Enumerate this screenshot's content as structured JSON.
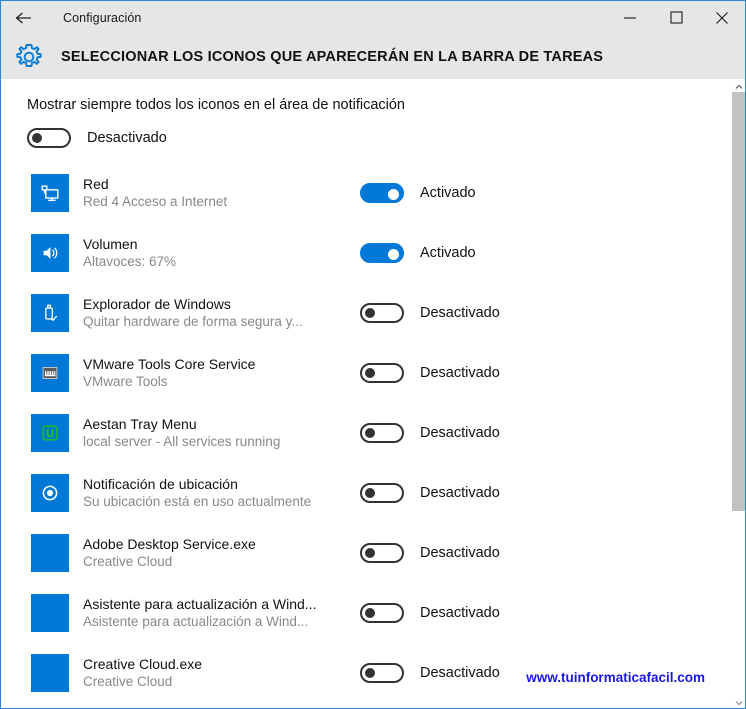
{
  "window": {
    "title": "Configuración",
    "back_icon": "back-arrow-icon",
    "minimize_label": "–",
    "maximize_label": "□",
    "close_label": "✕"
  },
  "header": {
    "icon": "gear-icon",
    "heading": "SELECCIONAR LOS ICONOS QUE APARECERÁN EN LA BARRA DE TAREAS"
  },
  "colors": {
    "accent": "#0078d7",
    "titlebar_bg": "#e6e6e6",
    "border": "#2b88d8",
    "watermark": "#1a18e8",
    "subtitle": "#888888"
  },
  "main": {
    "show_all_label": "Mostrar siempre todos los iconos en el área de notificación",
    "show_all_toggle": {
      "state": "off",
      "label": "Desactivado"
    },
    "items": [
      {
        "icon": "network-monitor-icon",
        "name": "Red",
        "subtitle": "Red  4 Acceso a Internet",
        "toggle": {
          "state": "on",
          "label": "Activado"
        }
      },
      {
        "icon": "volume-speaker-icon",
        "name": "Volumen",
        "subtitle": "Altavoces: 67%",
        "toggle": {
          "state": "on",
          "label": "Activado"
        }
      },
      {
        "icon": "usb-safely-remove-icon",
        "name": "Explorador de Windows",
        "subtitle": "Quitar hardware de forma segura y...",
        "toggle": {
          "state": "off",
          "label": "Desactivado"
        }
      },
      {
        "icon": "vmware-tools-icon",
        "name": "VMware Tools Core Service",
        "subtitle": "VMware Tools",
        "toggle": {
          "state": "off",
          "label": "Desactivado"
        }
      },
      {
        "icon": "aestan-tray-menu-icon",
        "name": "Aestan Tray Menu",
        "subtitle": "local server - All services running",
        "toggle": {
          "state": "off",
          "label": "Desactivado"
        }
      },
      {
        "icon": "location-target-icon",
        "name": "Notificación de ubicación",
        "subtitle": "Su ubicación está en uso actualmente",
        "toggle": {
          "state": "off",
          "label": "Desactivado"
        }
      },
      {
        "icon": "blank-blue-icon",
        "name": "Adobe Desktop Service.exe",
        "subtitle": "Creative Cloud",
        "toggle": {
          "state": "off",
          "label": "Desactivado"
        }
      },
      {
        "icon": "blank-blue-icon",
        "name": "Asistente para actualización a Wind...",
        "subtitle": "Asistente para actualización a Wind...",
        "toggle": {
          "state": "off",
          "label": "Desactivado"
        }
      },
      {
        "icon": "blank-blue-icon",
        "name": "Creative Cloud.exe",
        "subtitle": "Creative Cloud",
        "toggle": {
          "state": "off",
          "label": "Desactivado"
        }
      }
    ]
  },
  "scrollbar": {
    "up_icon": "chevron-up-icon",
    "down_icon": "chevron-down-icon"
  },
  "watermark": "www.tuinformaticafacil.com"
}
